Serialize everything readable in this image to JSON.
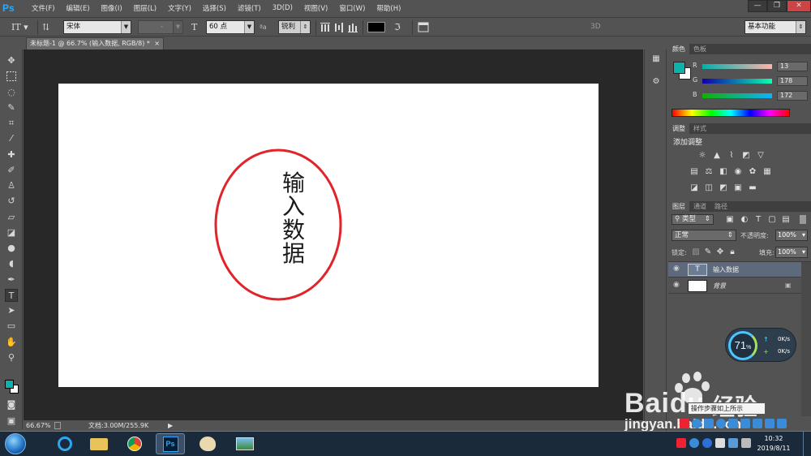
{
  "app": {
    "logo": "Ps"
  },
  "menu": [
    "文件(F)",
    "编辑(E)",
    "图像(I)",
    "图层(L)",
    "文字(Y)",
    "选择(S)",
    "滤镜(T)",
    "3D(D)",
    "视图(V)",
    "窗口(W)",
    "帮助(H)"
  ],
  "window_buttons": {
    "minimize": "—",
    "restore": "❐",
    "close": "✕"
  },
  "options": {
    "font_family": "宋体",
    "font_style": "-",
    "font_size": "60 点",
    "aa_label": "ªa",
    "antialias": "锐利",
    "three_d": "3D",
    "workspace": "基本功能",
    "text_color": "#000000"
  },
  "document": {
    "tab_title": "未标题-1 @ 66.7% (输入数据, RGB/8) *",
    "tab_close": "×",
    "text_chars": [
      "输",
      "入",
      "数",
      "据"
    ],
    "ellipse_color": "#e0242a"
  },
  "status": {
    "zoom": "66.67%",
    "doc_info": "文档:3.00M/255.9K"
  },
  "color_panel": {
    "tabs": [
      "颜色",
      "色板"
    ],
    "foreground": "#0db2ac",
    "r_label": "R",
    "g_label": "G",
    "b_label": "B",
    "r": "13",
    "g": "178",
    "b": "172"
  },
  "adjust_panel": {
    "tabs": [
      "调整",
      "样式"
    ],
    "title": "添加调整"
  },
  "layers_panel": {
    "tabs": [
      "图层",
      "通道",
      "路径"
    ],
    "kind_filter": "类型",
    "blend_mode": "正常",
    "opacity_label": "不透明度:",
    "opacity": "100%",
    "lock_label": "锁定:",
    "fill_label": "填充:",
    "fill": "100%",
    "layers": [
      {
        "name": "输入数据",
        "thumb": "T"
      },
      {
        "name": "背景"
      }
    ]
  },
  "net_monitor": {
    "percent": "71",
    "unit": "%",
    "up": "0K/s",
    "down": "0K/s"
  },
  "watermark": {
    "brand": "Baidu",
    "jingyan": "经验",
    "url": "jingyan.baidu.com",
    "tooltip": "操作步骤如上所示"
  },
  "clock": {
    "time": "10:32",
    "date": "2019/8/11"
  }
}
